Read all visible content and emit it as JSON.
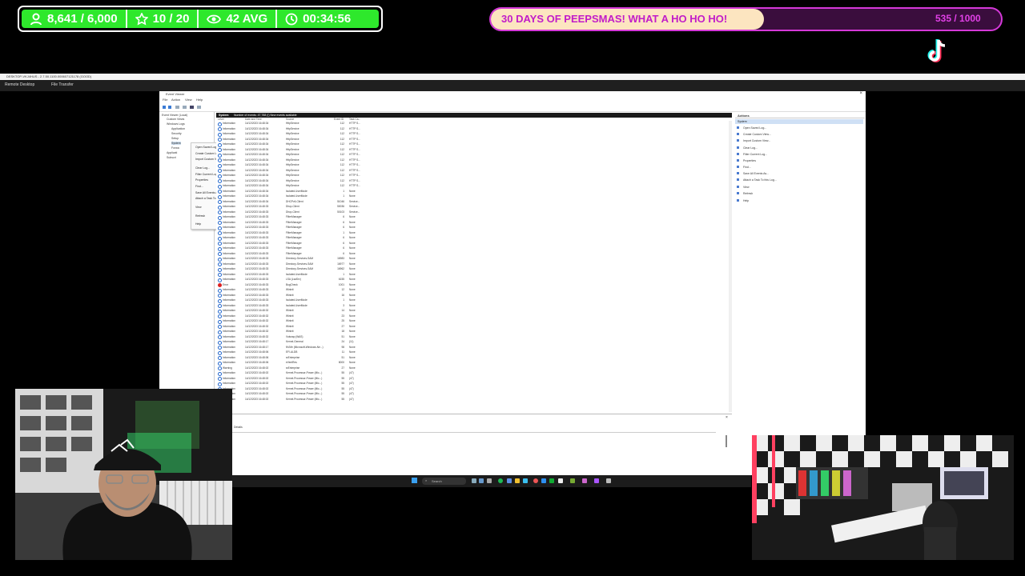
{
  "stats": {
    "followers": "8,641 / 6,000",
    "stars": "10 / 20",
    "viewers": "42 AVG",
    "timer": "00:34:56"
  },
  "goal": {
    "title": "30 DAYS OF PEEPSMAS! WHAT A HO HO HO!",
    "count": "535 / 1000",
    "progress": 0.535
  },
  "remote": {
    "title": "DESKTOP-VKJ4HUS - 2.7.50.1100.000607121178 (GOOD)",
    "tabs": [
      "Remote Desktop",
      "File Transfer"
    ]
  },
  "event_viewer": {
    "title": "Event Viewer",
    "menu": [
      "File",
      "Action",
      "View",
      "Help"
    ],
    "tree": [
      "Event Viewer (Local)",
      "Custom Views",
      "Windows Logs",
      "Application",
      "Security",
      "Setup",
      "System",
      "Forwa",
      "Applicati",
      "Subscri"
    ],
    "context_menu": [
      "Open Saved Log...",
      "Create Custom View...",
      "Import Custom View...",
      "Clear Log...",
      "Filter Current Log...",
      "Properties",
      "Find...",
      "Save All Events As...",
      "Attach a Task To this Log...",
      "View",
      "Refresh",
      "Help"
    ],
    "log_header": "System",
    "log_summary": "Number of events: 47,788 (!) New events available",
    "columns": [
      "Level",
      "Date and Time",
      "Source",
      "Event ID",
      "Task Ca..."
    ],
    "rows": [
      [
        "Information",
        "14/12/2023 16:48:34",
        "HttpService",
        "112",
        "HTTP S..."
      ],
      [
        "Information",
        "14/12/2023 16:48:34",
        "HttpService",
        "112",
        "HTTP S..."
      ],
      [
        "Information",
        "14/12/2023 16:48:34",
        "HttpService",
        "112",
        "HTTP S..."
      ],
      [
        "Information",
        "14/12/2023 16:48:34",
        "HttpService",
        "112",
        "HTTP S..."
      ],
      [
        "Information",
        "14/12/2023 16:48:34",
        "HttpService",
        "112",
        "HTTP S..."
      ],
      [
        "Information",
        "14/12/2023 16:48:34",
        "HttpService",
        "112",
        "HTTP S..."
      ],
      [
        "Information",
        "14/12/2023 16:48:34",
        "HttpService",
        "112",
        "HTTP S..."
      ],
      [
        "Information",
        "14/12/2023 16:48:34",
        "HttpService",
        "112",
        "HTTP S..."
      ],
      [
        "Information",
        "14/12/2023 16:48:34",
        "HttpService",
        "112",
        "HTTP S..."
      ],
      [
        "Information",
        "14/12/2023 16:48:34",
        "HttpService",
        "112",
        "HTTP S..."
      ],
      [
        "Information",
        "14/12/2023 16:48:34",
        "HttpService",
        "112",
        "HTTP S..."
      ],
      [
        "Information",
        "14/12/2023 16:48:34",
        "HttpService",
        "112",
        "HTTP S..."
      ],
      [
        "Information",
        "14/12/2023 16:48:34",
        "HttpService",
        "112",
        "HTTP S..."
      ],
      [
        "Information",
        "14/12/2023 16:48:34",
        "Isolated.UserMode",
        "1",
        "None"
      ],
      [
        "Information",
        "14/12/2023 16:48:34",
        "Isolated.UserMode",
        "1",
        "None"
      ],
      [
        "Information",
        "14/12/2023 16:48:34",
        "DHCPv6-Client",
        "51046",
        "Service..."
      ],
      [
        "Information",
        "14/12/2023 16:48:33",
        "Dhcp-Client",
        "50036",
        "Service..."
      ],
      [
        "Information",
        "14/12/2023 16:48:33",
        "Dhcp-Client",
        "50103",
        "Service..."
      ],
      [
        "Information",
        "14/12/2023 16:48:33",
        "FilterManager",
        "6",
        "None"
      ],
      [
        "Information",
        "14/12/2023 16:48:33",
        "FilterManager",
        "6",
        "None"
      ],
      [
        "Information",
        "14/12/2023 16:48:33",
        "FilterManager",
        "6",
        "None"
      ],
      [
        "Information",
        "14/12/2023 16:48:33",
        "FilterManager",
        "1",
        "None"
      ],
      [
        "Information",
        "14/12/2023 16:48:33",
        "FilterManager",
        "6",
        "None"
      ],
      [
        "Information",
        "14/12/2023 16:48:33",
        "FilterManager",
        "6",
        "None"
      ],
      [
        "Information",
        "14/12/2023 16:48:33",
        "FilterManager",
        "6",
        "None"
      ],
      [
        "Information",
        "14/12/2023 16:48:33",
        "FilterManager",
        "6",
        "None"
      ],
      [
        "Information",
        "14/12/2023 16:48:33",
        "Directory-Services-SAM",
        "16983",
        "None"
      ],
      [
        "Information",
        "14/12/2023 16:48:33",
        "Directory-Services-SAM",
        "16977",
        "None"
      ],
      [
        "Information",
        "14/12/2023 16:48:33",
        "Directory-Services-SAM",
        "16962",
        "None"
      ],
      [
        "Information",
        "14/12/2023 16:48:33",
        "Isolated.UserMode",
        "1",
        "None"
      ],
      [
        "Information",
        "14/12/2023 16:48:33",
        "LSA (LsaSrv)",
        "6155",
        "None"
      ],
      [
        "Error",
        "14/12/2023 16:48:33",
        "BugCheck",
        "1001",
        "None"
      ],
      [
        "Information",
        "14/12/2023 16:48:33",
        "Wininit",
        "12",
        "None"
      ],
      [
        "Information",
        "14/12/2023 16:48:33",
        "Wininit",
        "16",
        "None"
      ],
      [
        "Information",
        "14/12/2023 16:48:33",
        "Isolated.UserMode",
        "1",
        "None"
      ],
      [
        "Information",
        "14/12/2023 16:48:33",
        "Isolated.UserMode",
        "3",
        "None"
      ],
      [
        "Information",
        "14/12/2023 16:48:32",
        "Wininit",
        "14",
        "None"
      ],
      [
        "Information",
        "14/12/2023 16:48:32",
        "Wininit",
        "23",
        "None"
      ],
      [
        "Information",
        "14/12/2023 16:48:32",
        "Wininit",
        "25",
        "None"
      ],
      [
        "Information",
        "14/12/2023 16:48:32",
        "Wininit",
        "27",
        "None"
      ],
      [
        "Information",
        "14/12/2023 16:48:32",
        "Wininit",
        "18",
        "None"
      ],
      [
        "Information",
        "14/12/2023 16:48:32",
        "Volsnap (WAS)",
        "51",
        "None"
      ],
      [
        "Information",
        "14/12/2023 16:48:17",
        "Kernel-General",
        "24",
        "(11)"
      ],
      [
        "Information",
        "14/12/2023 16:48:17",
        "NVMe (Microsoft-Windows-Ne...)",
        "98",
        "None"
      ],
      [
        "Information",
        "14/12/2023 16:48:06",
        "EFI-ALDB",
        "11",
        "None"
      ],
      [
        "Information",
        "14/12/2023 16:48:06",
        "srEnterprise",
        "51",
        "None"
      ],
      [
        "Information",
        "14/12/2023 16:48:06",
        "eVentRes",
        "8000",
        "None"
      ],
      [
        "Warning",
        "14/12/2023 16:48:02",
        "srEnterprise",
        "27",
        "None"
      ],
      [
        "Information",
        "14/12/2023 16:48:02",
        "Kernel-Processor-Power (Mic...)",
        "55",
        "(47)"
      ],
      [
        "Information",
        "14/12/2023 16:48:02",
        "Kernel-Processor-Power (Mic...)",
        "55",
        "(47)"
      ],
      [
        "Information",
        "14/12/2023 16:48:02",
        "Kernel-Processor-Power (Mic...)",
        "55",
        "(47)"
      ],
      [
        "Information",
        "14/12/2023 16:48:02",
        "Kernel-Processor-Power (Mic...)",
        "55",
        "(47)"
      ],
      [
        "Information",
        "14/12/2023 16:48:02",
        "Kernel-Processor-Power (Mic...)",
        "55",
        "(47)"
      ],
      [
        "Information",
        "14/12/2023 16:48:02",
        "Kernel-Processor-Power (Mic...)",
        "55",
        "(47)"
      ]
    ],
    "actions_title": "Actions",
    "actions_section": "System",
    "actions": [
      "Open Saved Log...",
      "Create Custom View...",
      "Import Custom View...",
      "Clear Log...",
      "Filter Current Log...",
      "Properties",
      "Find...",
      "Save All Events As...",
      "Attach a Task To this Log...",
      "View",
      "Refresh",
      "Help"
    ],
    "detail_tab": "Details"
  },
  "taskbar": {
    "search_placeholder": "Search"
  },
  "colors": {
    "stat_green": "#2ee82c",
    "goal_border": "#d438d8",
    "goal_fill": "#fce5c0",
    "goal_text": "#c21cc8"
  }
}
